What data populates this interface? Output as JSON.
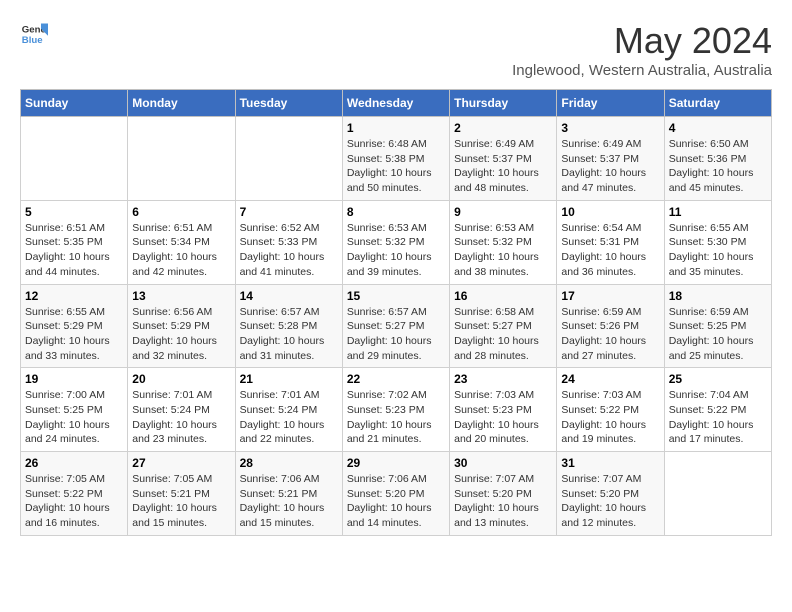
{
  "header": {
    "logo_general": "General",
    "logo_blue": "Blue",
    "main_title": "May 2024",
    "subtitle": "Inglewood, Western Australia, Australia"
  },
  "weekdays": [
    "Sunday",
    "Monday",
    "Tuesday",
    "Wednesday",
    "Thursday",
    "Friday",
    "Saturday"
  ],
  "weeks": [
    [
      {
        "day": "",
        "info": ""
      },
      {
        "day": "",
        "info": ""
      },
      {
        "day": "",
        "info": ""
      },
      {
        "day": "1",
        "info": "Sunrise: 6:48 AM\nSunset: 5:38 PM\nDaylight: 10 hours\nand 50 minutes."
      },
      {
        "day": "2",
        "info": "Sunrise: 6:49 AM\nSunset: 5:37 PM\nDaylight: 10 hours\nand 48 minutes."
      },
      {
        "day": "3",
        "info": "Sunrise: 6:49 AM\nSunset: 5:37 PM\nDaylight: 10 hours\nand 47 minutes."
      },
      {
        "day": "4",
        "info": "Sunrise: 6:50 AM\nSunset: 5:36 PM\nDaylight: 10 hours\nand 45 minutes."
      }
    ],
    [
      {
        "day": "5",
        "info": "Sunrise: 6:51 AM\nSunset: 5:35 PM\nDaylight: 10 hours\nand 44 minutes."
      },
      {
        "day": "6",
        "info": "Sunrise: 6:51 AM\nSunset: 5:34 PM\nDaylight: 10 hours\nand 42 minutes."
      },
      {
        "day": "7",
        "info": "Sunrise: 6:52 AM\nSunset: 5:33 PM\nDaylight: 10 hours\nand 41 minutes."
      },
      {
        "day": "8",
        "info": "Sunrise: 6:53 AM\nSunset: 5:32 PM\nDaylight: 10 hours\nand 39 minutes."
      },
      {
        "day": "9",
        "info": "Sunrise: 6:53 AM\nSunset: 5:32 PM\nDaylight: 10 hours\nand 38 minutes."
      },
      {
        "day": "10",
        "info": "Sunrise: 6:54 AM\nSunset: 5:31 PM\nDaylight: 10 hours\nand 36 minutes."
      },
      {
        "day": "11",
        "info": "Sunrise: 6:55 AM\nSunset: 5:30 PM\nDaylight: 10 hours\nand 35 minutes."
      }
    ],
    [
      {
        "day": "12",
        "info": "Sunrise: 6:55 AM\nSunset: 5:29 PM\nDaylight: 10 hours\nand 33 minutes."
      },
      {
        "day": "13",
        "info": "Sunrise: 6:56 AM\nSunset: 5:29 PM\nDaylight: 10 hours\nand 32 minutes."
      },
      {
        "day": "14",
        "info": "Sunrise: 6:57 AM\nSunset: 5:28 PM\nDaylight: 10 hours\nand 31 minutes."
      },
      {
        "day": "15",
        "info": "Sunrise: 6:57 AM\nSunset: 5:27 PM\nDaylight: 10 hours\nand 29 minutes."
      },
      {
        "day": "16",
        "info": "Sunrise: 6:58 AM\nSunset: 5:27 PM\nDaylight: 10 hours\nand 28 minutes."
      },
      {
        "day": "17",
        "info": "Sunrise: 6:59 AM\nSunset: 5:26 PM\nDaylight: 10 hours\nand 27 minutes."
      },
      {
        "day": "18",
        "info": "Sunrise: 6:59 AM\nSunset: 5:25 PM\nDaylight: 10 hours\nand 25 minutes."
      }
    ],
    [
      {
        "day": "19",
        "info": "Sunrise: 7:00 AM\nSunset: 5:25 PM\nDaylight: 10 hours\nand 24 minutes."
      },
      {
        "day": "20",
        "info": "Sunrise: 7:01 AM\nSunset: 5:24 PM\nDaylight: 10 hours\nand 23 minutes."
      },
      {
        "day": "21",
        "info": "Sunrise: 7:01 AM\nSunset: 5:24 PM\nDaylight: 10 hours\nand 22 minutes."
      },
      {
        "day": "22",
        "info": "Sunrise: 7:02 AM\nSunset: 5:23 PM\nDaylight: 10 hours\nand 21 minutes."
      },
      {
        "day": "23",
        "info": "Sunrise: 7:03 AM\nSunset: 5:23 PM\nDaylight: 10 hours\nand 20 minutes."
      },
      {
        "day": "24",
        "info": "Sunrise: 7:03 AM\nSunset: 5:22 PM\nDaylight: 10 hours\nand 19 minutes."
      },
      {
        "day": "25",
        "info": "Sunrise: 7:04 AM\nSunset: 5:22 PM\nDaylight: 10 hours\nand 17 minutes."
      }
    ],
    [
      {
        "day": "26",
        "info": "Sunrise: 7:05 AM\nSunset: 5:22 PM\nDaylight: 10 hours\nand 16 minutes."
      },
      {
        "day": "27",
        "info": "Sunrise: 7:05 AM\nSunset: 5:21 PM\nDaylight: 10 hours\nand 15 minutes."
      },
      {
        "day": "28",
        "info": "Sunrise: 7:06 AM\nSunset: 5:21 PM\nDaylight: 10 hours\nand 15 minutes."
      },
      {
        "day": "29",
        "info": "Sunrise: 7:06 AM\nSunset: 5:20 PM\nDaylight: 10 hours\nand 14 minutes."
      },
      {
        "day": "30",
        "info": "Sunrise: 7:07 AM\nSunset: 5:20 PM\nDaylight: 10 hours\nand 13 minutes."
      },
      {
        "day": "31",
        "info": "Sunrise: 7:07 AM\nSunset: 5:20 PM\nDaylight: 10 hours\nand 12 minutes."
      },
      {
        "day": "",
        "info": ""
      }
    ]
  ]
}
